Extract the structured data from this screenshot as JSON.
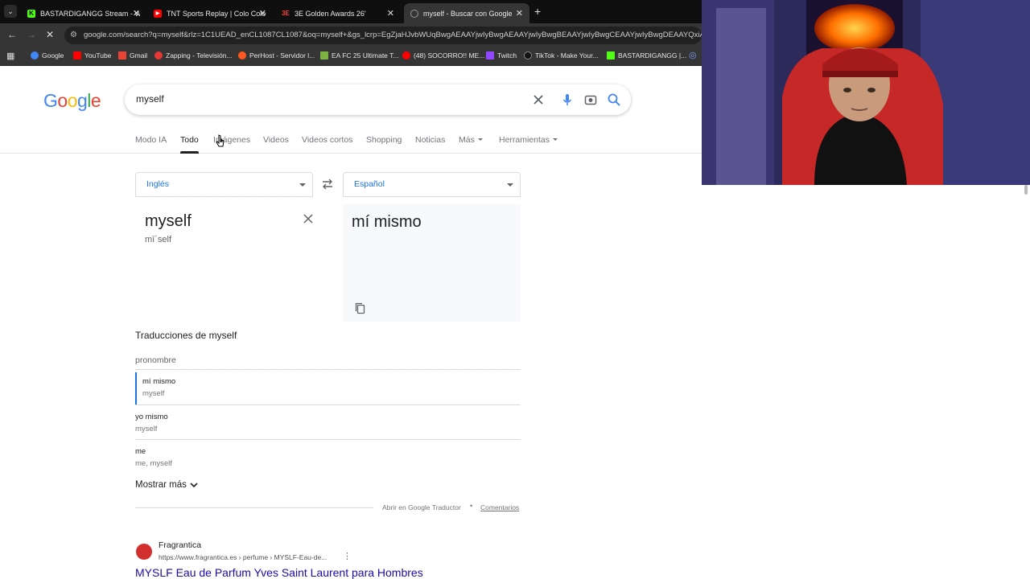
{
  "tabs": [
    {
      "title": "BASTARDIGANGG Stream - Wa",
      "icon": "kick-icon",
      "active": false
    },
    {
      "title": "TNT Sports Replay | Colo Colo",
      "icon": "youtube-icon",
      "active": false
    },
    {
      "title": "3E Golden Awards 26'",
      "icon": "3e-icon",
      "active": false
    },
    {
      "title": "myself - Buscar con Google",
      "icon": "google-icon",
      "active": true
    }
  ],
  "url": "google.com/search?q=myself&rlz=1C1UEAD_enCL1087CL1087&oq=myself+&gs_lcrp=EgZjaHJvbWUqBwgAEAAYjwIyBwgAEAAYjwIyBwgBEAAYjwIyBwgCEAAYjwIyBwgDEAAYQxiABBiKBTIHCAIQABiABDIHCAMQABiABD",
  "bookmarks": [
    {
      "label": "Google",
      "color": "#4285f4"
    },
    {
      "label": "YouTube",
      "color": "#ff0000"
    },
    {
      "label": "Gmail",
      "color": "#ea4335"
    },
    {
      "label": "Zapping - Televisión...",
      "color": "#e53935"
    },
    {
      "label": "PerHost - Servidor l...",
      "color": "#ff5722"
    },
    {
      "label": "EA FC 25 Ultimate T...",
      "color": "#7cb342"
    },
    {
      "label": "(48) SOCORRO!! ME...",
      "color": "#ff0000"
    },
    {
      "label": "Twitch",
      "color": "#9146ff"
    },
    {
      "label": "TikTok - Make Your...",
      "color": "#000000"
    },
    {
      "label": "BASTARDIGANGG |...",
      "color": "#53fc18"
    }
  ],
  "google": {
    "logo": "Google",
    "query": "myself",
    "nav_tabs": [
      "Modo IA",
      "Todo",
      "Imágenes",
      "Videos",
      "Videos cortos",
      "Shopping",
      "Noticias",
      "Más",
      "Herramientas"
    ],
    "active_tab": "Todo"
  },
  "translate": {
    "source_lang": "Inglés",
    "target_lang": "Español",
    "source_text": "myself",
    "phonetic": "mī´self",
    "target_text": "mí mismo",
    "translations_title": "Traducciones de myself",
    "part_of_speech": "pronombre",
    "rows": [
      {
        "word": "mí mismo",
        "back": "myself"
      },
      {
        "word": "yo mismo",
        "back": "myself"
      },
      {
        "word": "me",
        "back": "me, myself"
      }
    ],
    "show_more": "Mostrar más",
    "open_in": "Abrir en Google Traductor",
    "separator": "•",
    "feedback": "Comentarios"
  },
  "result": {
    "site": "Fragrantica",
    "url": "https://www.fragrantica.es › perfume › MYSLF-Eau-de...",
    "title": "MYSLF Eau de Parfum Yves Saint Laurent para Hombres"
  },
  "colors": {
    "accent": "#1a73e8",
    "link": "#1a0dab"
  }
}
